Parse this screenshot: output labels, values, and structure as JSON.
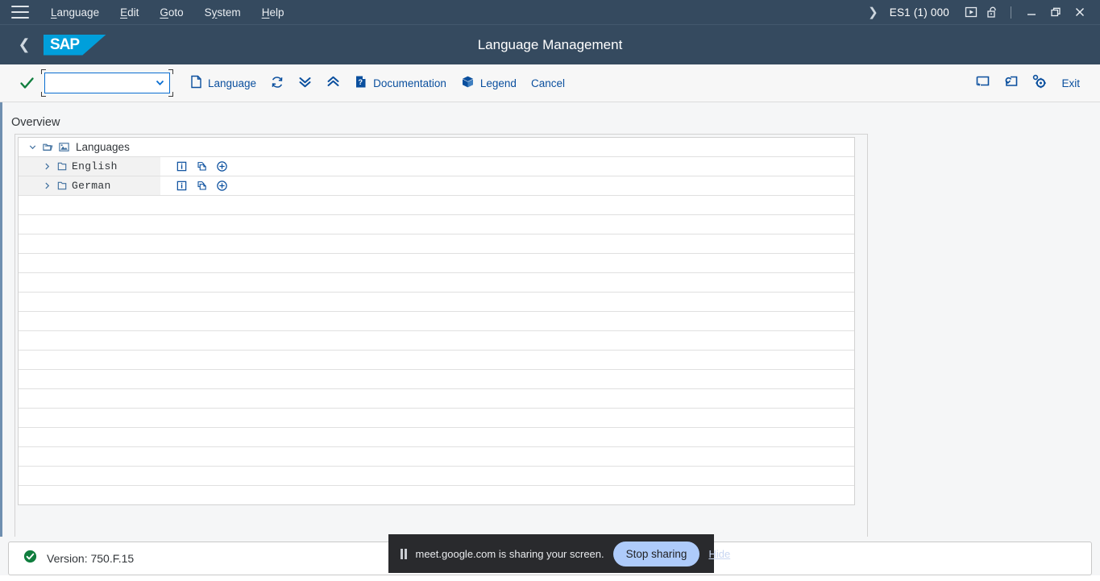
{
  "menubar": {
    "hamburger_icon": "hamburger-menu-icon",
    "items": [
      {
        "label": "Language",
        "accel": "L"
      },
      {
        "label": "Edit",
        "accel": "E"
      },
      {
        "label": "Goto",
        "accel": "G"
      },
      {
        "label": "System",
        "accel": "y"
      },
      {
        "label": "Help",
        "accel": "H"
      }
    ],
    "expand_icon": "chevron-right-icon",
    "system_id": "ES1 (1) 000",
    "play_icon": "play-in-box-icon",
    "lock_icon": "open-padlock-icon",
    "minimize_label": "—",
    "restore_icon": "restore-window-icon",
    "close_label": "✕"
  },
  "header": {
    "back_icon": "back-chevron-icon",
    "logo_text": "SAP",
    "title": "Language Management"
  },
  "toolbar": {
    "confirm_icon": "green-check-icon",
    "command_field": {
      "value": "",
      "placeholder": ""
    },
    "language_label": "Language",
    "language_icon": "document-icon",
    "refresh_icon": "refresh-icon",
    "expand_all_icon": "double-chevron-down-icon",
    "collapse_all_icon": "double-chevron-up-icon",
    "documentation_label": "Documentation",
    "documentation_icon": "help-document-icon",
    "legend_label": "Legend",
    "legend_icon": "cube-icon",
    "cancel_label": "Cancel",
    "new_window_icon": "create-favorite-icon",
    "new_session_icon": "new-session-icon",
    "customize_icon": "gear-customize-icon",
    "exit_label": "Exit"
  },
  "content": {
    "overview_label": "Overview",
    "tree": {
      "root": {
        "label": "Languages",
        "twisty": "expanded",
        "twisty_icon": "chevron-down-icon",
        "folder_icon": "open-folder-icon",
        "image_icon": "image-icon"
      },
      "nodes": [
        {
          "label": "English",
          "twisty": "collapsed",
          "twisty_icon": "chevron-right-icon",
          "folder_icon": "folder-icon",
          "actions": [
            {
              "icon": "info-icon",
              "name": "info-action"
            },
            {
              "icon": "documents-stack-icon",
              "name": "details-action"
            },
            {
              "icon": "circle-plus-icon",
              "name": "add-action"
            }
          ]
        },
        {
          "label": "German",
          "twisty": "collapsed",
          "twisty_icon": "chevron-right-icon",
          "folder_icon": "folder-icon",
          "actions": [
            {
              "icon": "info-icon",
              "name": "info-action"
            },
            {
              "icon": "documents-stack-icon",
              "name": "details-action"
            },
            {
              "icon": "circle-plus-icon",
              "name": "add-action"
            }
          ]
        }
      ],
      "empty_row_count": 17
    }
  },
  "status": {
    "icon": "green-success-icon",
    "text": "Version: 750.F.15"
  },
  "share_toast": {
    "pause_icon": "pause-icon",
    "message": "meet.google.com is sharing your screen.",
    "stop_label": "Stop sharing",
    "hide_label": "Hide"
  },
  "colors": {
    "header_bg": "#354a5f",
    "sap_blue": "#009fdb",
    "accent_link": "#0a4f9e",
    "focus_border": "#0a6ed1",
    "success_green": "#107e3e",
    "toast_bg": "#292a2d",
    "toast_button": "#aecbfa"
  }
}
